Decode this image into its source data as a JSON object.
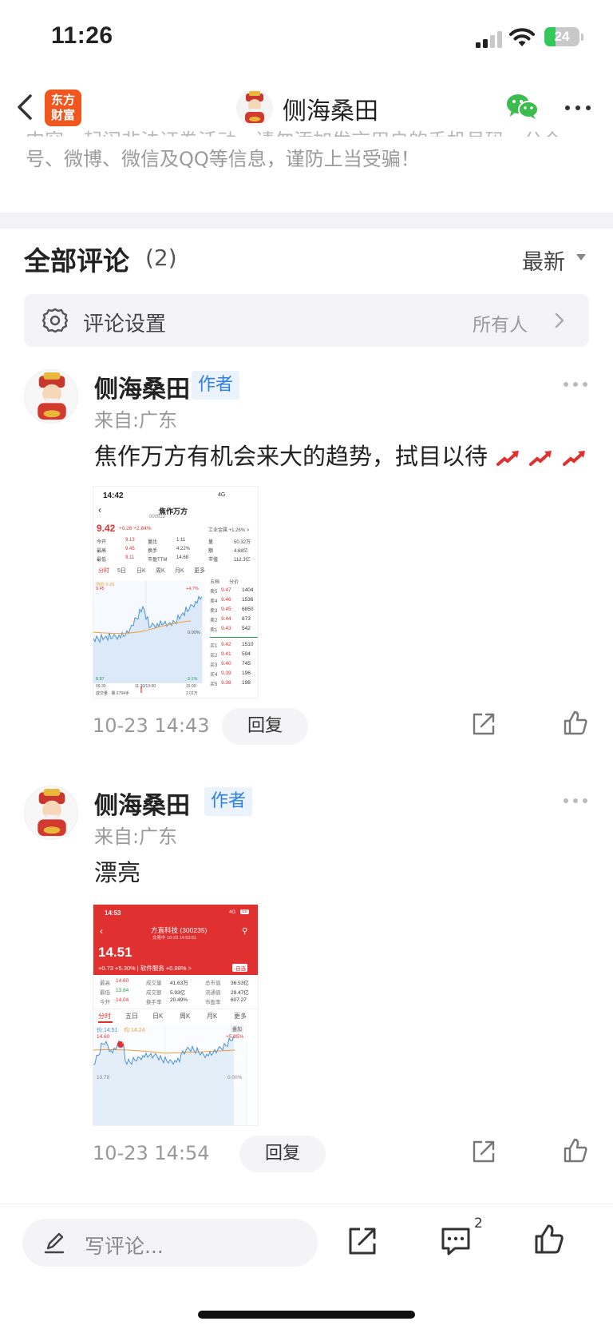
{
  "status_bar": {
    "time": "11:26",
    "battery": "24"
  },
  "nav": {
    "logo_line1": "东方",
    "logo_line2": "财富",
    "title": "侧海桑田"
  },
  "notice": {
    "partial_line": "内容，起闹非法证券活动。请勿添加发言用户的手机号码、公众",
    "text": "号、微博、微信及QQ等信息，谨防上当受骗！"
  },
  "comments_section": {
    "title": "全部评论",
    "count": "(2)",
    "sort": "最新",
    "settings_label": "评论设置",
    "settings_value": "所有人"
  },
  "comments": [
    {
      "user": "侧海桑田",
      "badge": "作者",
      "from": "来自:广东",
      "text": "焦作万方有机会来大的趋势，拭目以待",
      "time": "10-23 14:43",
      "reply": "回复",
      "image": {
        "time": "14:42",
        "signal": "4G",
        "name": "焦作万方",
        "code": "000612",
        "price": "9.42",
        "change": "+0.26 +2.84%",
        "stats": [
          [
            "今开",
            "9.13",
            "量比",
            "1.11",
            "量",
            "50.32万"
          ],
          [
            "最高",
            "9.45",
            "换手",
            "4.22%",
            "额",
            "4.68亿"
          ],
          [
            "最低",
            "9.11",
            "市盈TTM",
            "14.68",
            "市值",
            "112.3亿"
          ]
        ],
        "industry": "工业金属 +1.26% >",
        "tabs": [
          "分时",
          "5日",
          "日K",
          "周K",
          "月K",
          "更多"
        ],
        "book_tabs": [
          "五档",
          "分价"
        ],
        "sells": [
          [
            "卖5",
            "9.47",
            "1404"
          ],
          [
            "卖4",
            "9.46",
            "1536"
          ],
          [
            "卖3",
            "9.45",
            "6850"
          ],
          [
            "卖2",
            "9.44",
            "873"
          ],
          [
            "卖1",
            "9.43",
            "542"
          ]
        ],
        "buys": [
          [
            "买1",
            "9.42",
            "1510"
          ],
          [
            "买2",
            "9.41",
            "594"
          ],
          [
            "买3",
            "9.40",
            "745"
          ],
          [
            "买4",
            "9.39",
            "196"
          ],
          [
            "买5",
            "9.38",
            "198"
          ]
        ],
        "avg_label": "均价:9.29",
        "chart_high": "9.45",
        "chart_low": "8.87",
        "pct_high": "+4.7%",
        "pct_zero": "0.00%",
        "pct_low": "-3.1%",
        "time_start": "09:30",
        "time_mid": "11:30/13:00",
        "time_end": "15:00",
        "vol_label": "成交量 · 量:1794手",
        "vol_max": "2.01万"
      }
    },
    {
      "user": "侧海桑田",
      "badge": "作者",
      "from": "来自:广东",
      "text": "漂亮",
      "time": "10-23 14:54",
      "reply": "回复",
      "image": {
        "time": "14:53",
        "signal": "4G",
        "battery": "59",
        "name": "方直科技 (300235)",
        "sub": "交易中 10-23 14:53:51",
        "price": "14.51",
        "change": "+0.73 +5.30% | 软件服务 +0.88% >",
        "watch": "-自选",
        "stats": [
          [
            "最高",
            "14.60",
            "成交量",
            "41.63万",
            "总市值",
            "36.53亿"
          ],
          [
            "最低",
            "13.84",
            "成交额",
            "5.93亿",
            "流通值",
            "29.47亿"
          ],
          [
            "今开",
            "14.04",
            "换手率",
            "20.49%",
            "市盈率",
            "607.27"
          ]
        ],
        "tabs": [
          "分时",
          "五日",
          "日K",
          "周K",
          "月K",
          "更多"
        ],
        "price_label": "价:14.51",
        "avg_label": "均:14.24",
        "overlay_label": "叠加",
        "chart_high": "14.60",
        "chart_low": "13.78",
        "pct_high": "+5.95%",
        "pct_zero": "0.00%",
        "marker": "B"
      }
    }
  ],
  "bottom_bar": {
    "placeholder": "写评论...",
    "comment_count": "2"
  },
  "colors": {
    "up": "#e0302f",
    "down": "#1fa14a",
    "accent": "#2f7fe0",
    "brand": "#f1561f"
  }
}
